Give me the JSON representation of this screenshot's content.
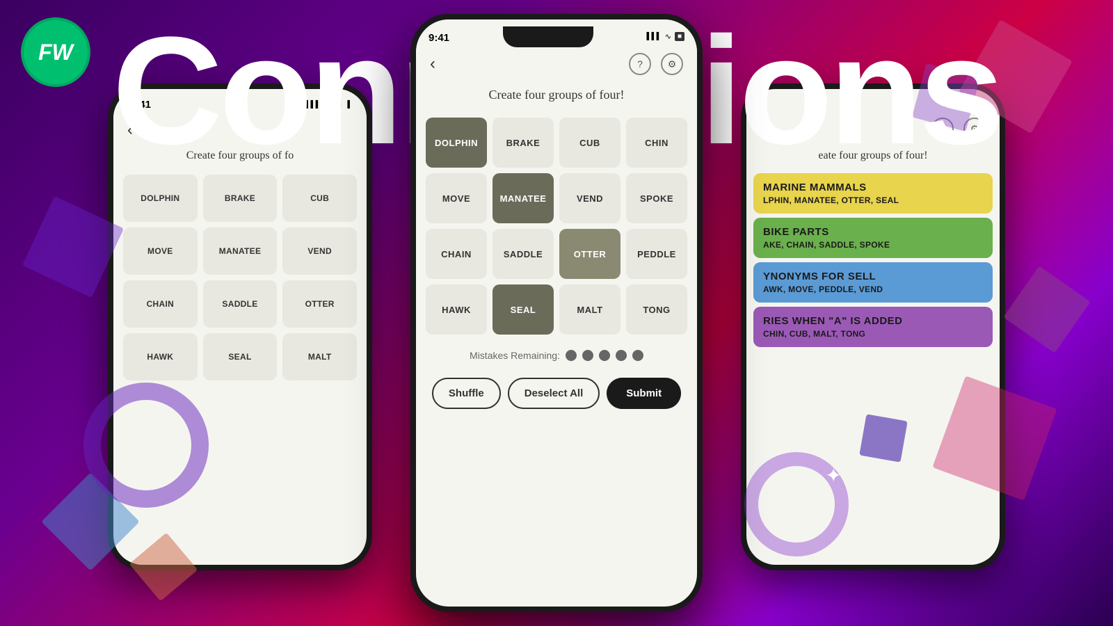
{
  "background": {
    "title": "Connections"
  },
  "logo": {
    "text": "FW"
  },
  "phone_center": {
    "status_time": "9:41",
    "game_title": "Create four groups of four!",
    "grid": [
      {
        "word": "DOLPHIN",
        "state": "selected-dark"
      },
      {
        "word": "BRAKE",
        "state": "normal"
      },
      {
        "word": "CUB",
        "state": "normal"
      },
      {
        "word": "CHIN",
        "state": "normal"
      },
      {
        "word": "MOVE",
        "state": "normal"
      },
      {
        "word": "MANATEE",
        "state": "selected-dark"
      },
      {
        "word": "VEND",
        "state": "normal"
      },
      {
        "word": "SPOKE",
        "state": "normal"
      },
      {
        "word": "CHAIN",
        "state": "normal"
      },
      {
        "word": "SADDLE",
        "state": "normal"
      },
      {
        "word": "OTTER",
        "state": "selected-medium"
      },
      {
        "word": "PEDDLE",
        "state": "normal"
      },
      {
        "word": "HAWK",
        "state": "normal"
      },
      {
        "word": "SEAL",
        "state": "selected-dark"
      },
      {
        "word": "MALT",
        "state": "normal"
      },
      {
        "word": "TONG",
        "state": "normal"
      }
    ],
    "mistakes_label": "Mistakes Remaining:",
    "dots": [
      true,
      true,
      true,
      true,
      true
    ],
    "buttons": {
      "shuffle": "Shuffle",
      "deselect": "Deselect All",
      "submit": "Submit"
    }
  },
  "phone_left": {
    "status_time": "9:41",
    "game_title": "Create four groups of fo",
    "grid": [
      {
        "word": "DOLPHIN"
      },
      {
        "word": "BRAKE"
      },
      {
        "word": "CUB"
      },
      {
        "word": "MOVE"
      },
      {
        "word": "MANATEE"
      },
      {
        "word": "VEND"
      },
      {
        "word": "CHAIN"
      },
      {
        "word": "SADDLE"
      },
      {
        "word": "OTTER"
      },
      {
        "word": "HAWK"
      },
      {
        "word": "SEAL"
      },
      {
        "word": "MALT"
      }
    ]
  },
  "phone_right": {
    "game_title": "eate four groups of four!",
    "categories": [
      {
        "color": "yellow",
        "name": "MARINE MAMMALS",
        "words": "LPHIN, MANATEE, OTTER, SEAL"
      },
      {
        "color": "green",
        "name": "BIKE PARTS",
        "words": "AKE, CHAIN, SADDLE, SPOKE"
      },
      {
        "color": "blue",
        "name": "YNONYMS FOR SELL",
        "words": "AWK, MOVE, PEDDLE, VEND"
      },
      {
        "color": "purple",
        "name": "RIES WHEN \"A\" IS ADDED",
        "words": "CHIN, CUB, MALT, TONG"
      }
    ]
  }
}
